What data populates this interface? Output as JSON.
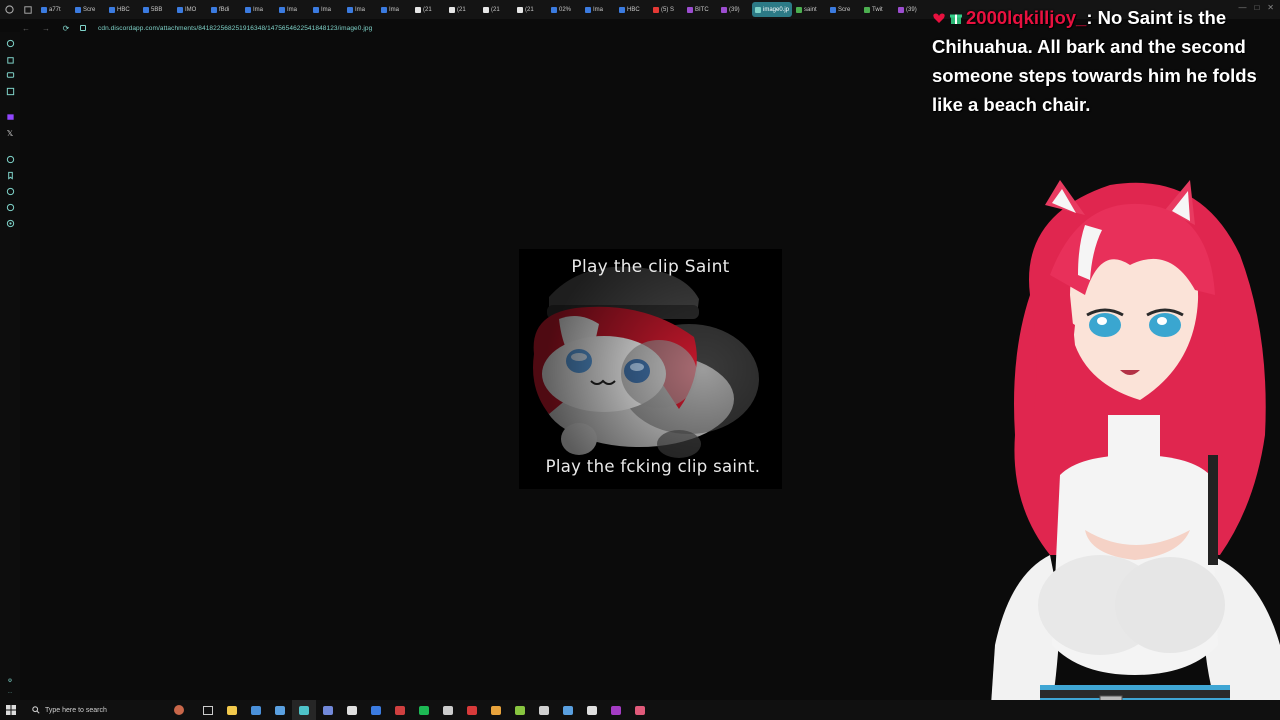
{
  "browser": {
    "tabs": [
      {
        "label": "a77t",
        "color": "#3b7be0"
      },
      {
        "label": "Scre",
        "color": "#3b7be0"
      },
      {
        "label": "HBC",
        "color": "#3b7be0"
      },
      {
        "label": "5BB",
        "color": "#3b7be0"
      },
      {
        "label": "IMO",
        "color": "#3b7be0"
      },
      {
        "label": "fBdi",
        "color": "#3b7be0"
      },
      {
        "label": "Ima",
        "color": "#3b7be0"
      },
      {
        "label": "Ima",
        "color": "#3b7be0"
      },
      {
        "label": "Ima",
        "color": "#3b7be0"
      },
      {
        "label": "Ima",
        "color": "#3b7be0"
      },
      {
        "label": "Ima",
        "color": "#3b7be0"
      },
      {
        "label": "(21",
        "color": "#e6e6e6"
      },
      {
        "label": "(21",
        "color": "#e6e6e6"
      },
      {
        "label": "(21",
        "color": "#e6e6e6"
      },
      {
        "label": "(21",
        "color": "#e6e6e6"
      },
      {
        "label": "02%",
        "color": "#3b7be0"
      },
      {
        "label": "Ima",
        "color": "#3b7be0"
      },
      {
        "label": "HBC",
        "color": "#3b7be0"
      },
      {
        "label": "(5) S",
        "color": "#e53935"
      },
      {
        "label": "BITC",
        "color": "#9c4dd0"
      },
      {
        "label": "(39)",
        "color": "#9c4dd0"
      },
      {
        "label": "image0.jp",
        "color": "#7fd3c9",
        "active": true
      },
      {
        "label": "saint",
        "color": "#4caf50"
      },
      {
        "label": "Scre",
        "color": "#3b7be0"
      },
      {
        "label": "Twit",
        "color": "#4caf50"
      },
      {
        "label": "(39)",
        "color": "#9c4dd0"
      }
    ],
    "url": "cdn.discordapp.com/attachments/841822568251916348/1475654622541848123/image0.jpg"
  },
  "meme": {
    "top_text": "Play the clip Saint",
    "bottom_text": "Play the fcking clip saint."
  },
  "chat": {
    "username": "2000lqkilljoy_",
    "message_first": ": No Saint is the",
    "message_rest": "Chihuahua. All bark and the second someone steps towards him he folds like a beach chair."
  },
  "taskbar": {
    "search_placeholder": "Type here to search",
    "apps": [
      {
        "name": "file-explorer",
        "color": "#f2c94c"
      },
      {
        "name": "chrome",
        "color": "#4a90d9"
      },
      {
        "name": "vpn",
        "color": "#5aa0e0"
      },
      {
        "name": "browser",
        "color": "#4ec3c9",
        "active": true
      },
      {
        "name": "discord",
        "color": "#7289da"
      },
      {
        "name": "obs",
        "color": "#e0e0e0"
      },
      {
        "name": "media",
        "color": "#3b7be0"
      },
      {
        "name": "calendar",
        "color": "#d04040"
      },
      {
        "name": "spotify",
        "color": "#1db954"
      },
      {
        "name": "steam",
        "color": "#cccccc"
      },
      {
        "name": "opera",
        "color": "#d83a3a"
      },
      {
        "name": "chrome-2",
        "color": "#e8a33c"
      },
      {
        "name": "app-green",
        "color": "#88c540"
      },
      {
        "name": "steam-2",
        "color": "#d0d0d0"
      },
      {
        "name": "steam-3",
        "color": "#5aa0e0"
      },
      {
        "name": "notepad",
        "color": "#e0e0e0"
      },
      {
        "name": "app-next",
        "color": "#a43cc4"
      },
      {
        "name": "app-pink",
        "color": "#e05a7a"
      }
    ]
  },
  "colors": {
    "accent": "#7fd3c9",
    "chat_username": "#e8113f"
  }
}
